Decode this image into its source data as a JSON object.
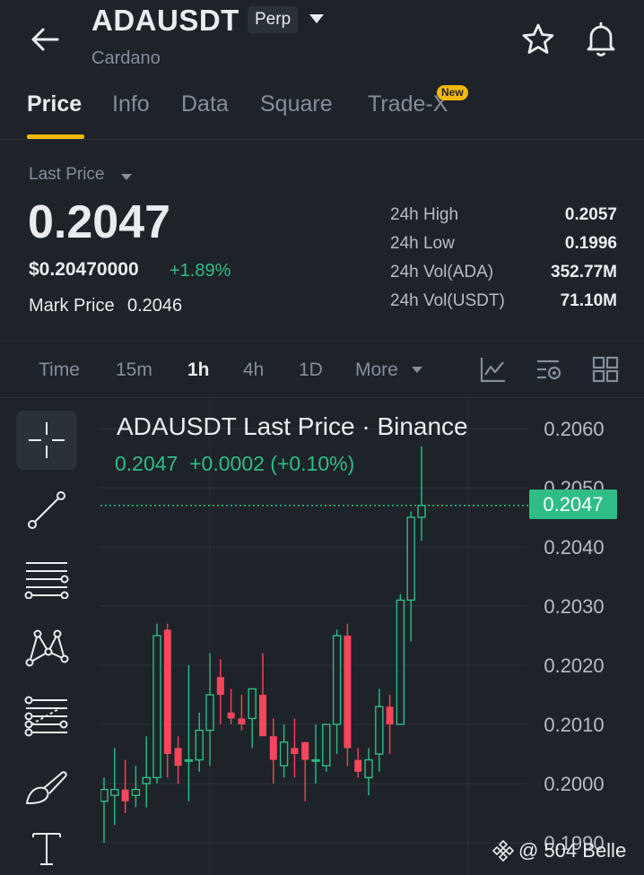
{
  "header": {
    "symbol": "ADAUSDT",
    "badge": "Perp",
    "subtitle": "Cardano",
    "icons": [
      "back-arrow-icon",
      "caret-down-icon",
      "star-icon",
      "bell-icon"
    ]
  },
  "tabs": [
    {
      "label": "Price",
      "active": true
    },
    {
      "label": "Info"
    },
    {
      "label": "Data"
    },
    {
      "label": "Square"
    },
    {
      "label": "Trade-X",
      "badge": "New"
    }
  ],
  "price": {
    "label": "Last Price",
    "value": "0.2047",
    "usd": "$0.20470000",
    "change": "+1.89%",
    "mark_label": "Mark Price",
    "mark_value": "0.2046"
  },
  "stats": [
    {
      "label": "24h High",
      "value": "0.2057"
    },
    {
      "label": "24h Low",
      "value": "0.1996"
    },
    {
      "label": "24h Vol(ADA)",
      "value": "352.77M"
    },
    {
      "label": "24h Vol(USDT)",
      "value": "71.10M"
    }
  ],
  "timeframes": {
    "items": [
      "Time",
      "15m",
      "1h",
      "4h",
      "1D"
    ],
    "active": "1h",
    "more": "More"
  },
  "chart_toolbar_icons": [
    "indicator-icon",
    "chart-settings-icon",
    "layout-grid-icon"
  ],
  "drawing_tools": [
    "crosshair-icon",
    "trend-line-icon",
    "horizontal-lines-icon",
    "pattern-icon",
    "fibonacci-icon",
    "brush-icon",
    "text-icon"
  ],
  "chart": {
    "title": "ADAUSDT Last Price · Binance",
    "ohlc": "0.2047  +0.0002 (+0.10%)",
    "current_price": "0.2047"
  },
  "watermark": "@ 504 Belle",
  "colors": {
    "background": "#1e2329",
    "up": "#2ebd85",
    "down": "#f6465d",
    "accent": "#f0b90b"
  },
  "chart_data": {
    "type": "candlestick",
    "title": "ADAUSDT Last Price · Binance",
    "ylim": [
      0.1985,
      0.2068
    ],
    "y_ticks": [
      "0.2060",
      "0.2050",
      "0.2040",
      "0.2030",
      "0.2020",
      "0.2010",
      "0.2000",
      "0.1990"
    ],
    "current_price": 0.2047,
    "candles": [
      {
        "o": 0.1997,
        "h": 0.2001,
        "l": 0.199,
        "c": 0.1999
      },
      {
        "o": 0.1998,
        "h": 0.2006,
        "l": 0.1993,
        "c": 0.1999
      },
      {
        "o": 0.1999,
        "h": 0.2004,
        "l": 0.1995,
        "c": 0.1997
      },
      {
        "o": 0.1998,
        "h": 0.2003,
        "l": 0.1996,
        "c": 0.1999
      },
      {
        "o": 0.2,
        "h": 0.2008,
        "l": 0.1996,
        "c": 0.2001
      },
      {
        "o": 0.2001,
        "h": 0.2027,
        "l": 0.2,
        "c": 0.2025
      },
      {
        "o": 0.2026,
        "h": 0.2027,
        "l": 0.2001,
        "c": 0.2005
      },
      {
        "o": 0.2006,
        "h": 0.2008,
        "l": 0.2,
        "c": 0.2003
      },
      {
        "o": 0.2004,
        "h": 0.202,
        "l": 0.1997,
        "c": 0.2004
      },
      {
        "o": 0.2004,
        "h": 0.2012,
        "l": 0.2002,
        "c": 0.2009
      },
      {
        "o": 0.2009,
        "h": 0.2022,
        "l": 0.2003,
        "c": 0.2015
      },
      {
        "o": 0.2018,
        "h": 0.2021,
        "l": 0.201,
        "c": 0.2015
      },
      {
        "o": 0.2012,
        "h": 0.2016,
        "l": 0.201,
        "c": 0.2011
      },
      {
        "o": 0.2011,
        "h": 0.2015,
        "l": 0.2009,
        "c": 0.201
      },
      {
        "o": 0.2011,
        "h": 0.2016,
        "l": 0.2006,
        "c": 0.2016
      },
      {
        "o": 0.2015,
        "h": 0.2022,
        "l": 0.2009,
        "c": 0.2008
      },
      {
        "o": 0.2008,
        "h": 0.2011,
        "l": 0.2,
        "c": 0.2004
      },
      {
        "o": 0.2003,
        "h": 0.201,
        "l": 0.2001,
        "c": 0.2007
      },
      {
        "o": 0.2006,
        "h": 0.2011,
        "l": 0.2001,
        "c": 0.2005
      },
      {
        "o": 0.2007,
        "h": 0.2007,
        "l": 0.1997,
        "c": 0.2004
      },
      {
        "o": 0.2004,
        "h": 0.201,
        "l": 0.2,
        "c": 0.2004
      },
      {
        "o": 0.2003,
        "h": 0.201,
        "l": 0.2002,
        "c": 0.201
      },
      {
        "o": 0.201,
        "h": 0.2026,
        "l": 0.2005,
        "c": 0.2025
      },
      {
        "o": 0.2025,
        "h": 0.2027,
        "l": 0.2003,
        "c": 0.2006
      },
      {
        "o": 0.2004,
        "h": 0.2006,
        "l": 0.2001,
        "c": 0.2002
      },
      {
        "o": 0.2001,
        "h": 0.2006,
        "l": 0.1998,
        "c": 0.2004
      },
      {
        "o": 0.2005,
        "h": 0.2016,
        "l": 0.2002,
        "c": 0.2013
      },
      {
        "o": 0.2013,
        "h": 0.2015,
        "l": 0.2005,
        "c": 0.201
      },
      {
        "o": 0.201,
        "h": 0.2032,
        "l": 0.201,
        "c": 0.2031
      },
      {
        "o": 0.2031,
        "h": 0.2046,
        "l": 0.2024,
        "c": 0.2045
      },
      {
        "o": 0.2045,
        "h": 0.2057,
        "l": 0.2041,
        "c": 0.2047
      }
    ]
  }
}
